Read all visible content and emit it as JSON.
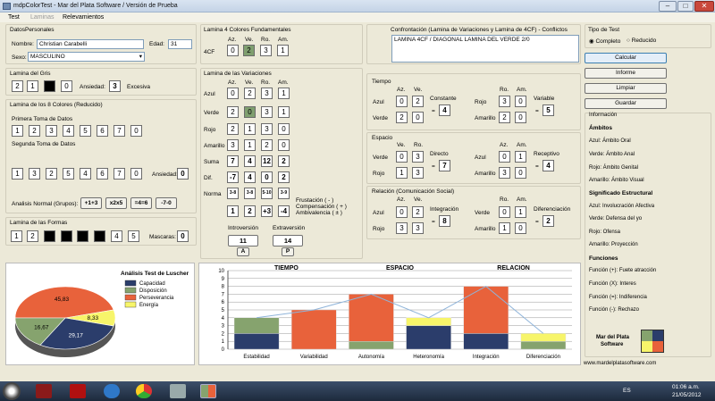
{
  "window": {
    "title": "mdpColorTest - Mar del Plata Software / Versión de Prueba"
  },
  "menu": {
    "test": "Test",
    "laminas": "Laminas",
    "relevamientos": "Relevamientos"
  },
  "datos": {
    "title": "DatosPersonales",
    "nombre_label": "Nombre:",
    "nombre": "Christian Carabelli",
    "edad_label": "Edad:",
    "edad": "31",
    "sexo_label": "Sexo:",
    "sexo": "MASCULINO"
  },
  "gris": {
    "title": "Lamina del Gris",
    "ansiedad_label": "Ansiedad:",
    "ansiedad": "3",
    "excesiva": "Excesiva"
  },
  "ocho": {
    "title": "Lamina de los 8 Colores (Reducido)",
    "primera": "Primera Toma de Datos",
    "segunda": "Segunda Toma de Datos",
    "row1": [
      "1",
      "2",
      "3",
      "4",
      "5",
      "6",
      "7",
      "0"
    ],
    "row2": [
      "1",
      "3",
      "2",
      "5",
      "4",
      "6",
      "7",
      "0"
    ],
    "ansiedad_label": "Ansiedad:",
    "ansiedad": "0",
    "normal_label": "Analisis Normal (Grupos):",
    "grupos": [
      "+1+3",
      "x2x5",
      "=4=6",
      "-7-0"
    ]
  },
  "formas": {
    "title": "Lamina de las Formas",
    "c1": "1",
    "c2": "2",
    "c7": "4",
    "c8": "5",
    "mascaras_label": "Mascaras:",
    "mascaras": "0"
  },
  "fund": {
    "title": "Lamina 4 Colores Fundamentales",
    "headers": [
      "Az.",
      "Ve.",
      "Ro.",
      "Am."
    ],
    "row_label": "4CF",
    "values": [
      "0",
      "2",
      "3",
      "1"
    ]
  },
  "variaciones": {
    "title": "Lamina de las Variaciones",
    "headers": [
      "Az.",
      "Ve.",
      "Ro.",
      "Am."
    ],
    "rows": [
      {
        "label": "Azul",
        "v": [
          "0",
          "2",
          "3",
          "1"
        ]
      },
      {
        "label": "Verde",
        "v": [
          "2",
          "0",
          "3",
          "1"
        ]
      },
      {
        "label": "Rojo",
        "v": [
          "2",
          "1",
          "3",
          "0"
        ]
      },
      {
        "label": "Amarillo",
        "v": [
          "3",
          "1",
          "2",
          "0"
        ]
      },
      {
        "label": "Suma",
        "v": [
          "7",
          "4",
          "12",
          "2"
        ]
      },
      {
        "label": "Dif.",
        "v": [
          "-7",
          "4",
          "0",
          "2"
        ]
      },
      {
        "label": "Norma",
        "v": [
          "3-8",
          "3-8",
          "5-10",
          "3-9"
        ]
      },
      {
        "label": "",
        "v": [
          "1",
          "2",
          "+3",
          "-4"
        ]
      }
    ],
    "frustacion": "Frustación ( - )",
    "compensacion": "Compensación ( + )",
    "ambivalencia": "Ambivalencia ( ± )",
    "intro_label": "Introversión",
    "intro": "11",
    "intro_tag": "A",
    "extra_label": "Extraversión",
    "extra": "14",
    "extra_tag": "P"
  },
  "confrontacion": {
    "title": "Confrontación (Lamina de Variaciones y Lamina de 4CF) - Conflictos",
    "text": "LAMINA 4CF / DIAGONAL LAMINA DEL VERDE 2/0"
  },
  "tiempo": {
    "title": "Tiempo",
    "az": "Az.",
    "ve": "Ve.",
    "ro": "Ro.",
    "am": "Am.",
    "azul": "Azul",
    "verde": "Verde",
    "rojo": "Rojo",
    "amarillo": "Amarillo",
    "l": [
      "0",
      "2",
      "2",
      "0"
    ],
    "constante_label": "Constante",
    "constante": "4",
    "r": [
      "3",
      "0",
      "2",
      "0"
    ],
    "variable_label": "Variable",
    "variable": "5"
  },
  "espacio": {
    "title": "Espacio",
    "ve": "Ve.",
    "ro": "Ro.",
    "az": "Az.",
    "am": "Am.",
    "verde": "Verde",
    "rojo": "Rojo",
    "azul": "Azul",
    "amarillo": "Amarillo",
    "l": [
      "0",
      "3",
      "1",
      "3"
    ],
    "directo_label": "Directo",
    "directo": "7",
    "r": [
      "0",
      "1",
      "3",
      "0"
    ],
    "receptivo_label": "Receptivo",
    "receptivo": "4"
  },
  "relacion": {
    "title": "Relación (Comunicación Social)",
    "az": "Az.",
    "ve": "Ve.",
    "ro": "Ro.",
    "am": "Am.",
    "azul": "Azul",
    "rojo": "Rojo",
    "verde": "Verde",
    "amarillo": "Amarillo",
    "l": [
      "0",
      "2",
      "3",
      "3"
    ],
    "integracion_label": "Integración",
    "integracion": "8",
    "r": [
      "0",
      "1",
      "1",
      "0"
    ],
    "diferenciacion_label": "Diferenciación",
    "diferenciacion": "2"
  },
  "tipo": {
    "title": "Tipo de Test",
    "completo": "Completo",
    "reducido": "Reducido"
  },
  "buttons": {
    "calcular": "Calcular",
    "informe": "Informe",
    "limpiar": "Limpiar",
    "guardar": "Guardar"
  },
  "info": {
    "title": "Información",
    "ambitos": "Ámbitos",
    "azul": "Azul: Ámbito Oral",
    "verde": "Verde: Ámbito Anal",
    "rojo": "Rojo: Ámbito Genital",
    "amarillo": "Amarillo: Ámbito Visual",
    "significado": "Significado Estructural",
    "s_azul": "Azul: Involucración Afectiva",
    "s_verde": "Verde: Defensa del yo",
    "s_rojo": "Rojo: Ofensa",
    "s_amarillo": "Amarillo: Proyección",
    "funciones": "Funciones",
    "f1": "Función (+): Fuete atracción",
    "f2": "Función (X): Interes",
    "f3": "Función (=): Indiferencia",
    "f4": "Función (-): Rechazo",
    "logo1": "Mar del Plata",
    "logo2": "Software",
    "website": "www.mardelplatasoftware.com"
  },
  "colors": {
    "capacidad": "#2b3d6b",
    "disposicion": "#86a36e",
    "perseverancia": "#e8623b",
    "energia": "#f7f56a"
  },
  "chart_data": [
    {
      "type": "pie",
      "title": "Análisis Test de Luscher",
      "labels": [
        "Capacidad",
        "Disposición",
        "Perseverancia",
        "Energía"
      ],
      "values": [
        29.17,
        16.67,
        45.83,
        8.33
      ],
      "value_labels": [
        "29,17",
        "16,67",
        "45,83",
        "8,33"
      ]
    },
    {
      "type": "bar",
      "stacked": true,
      "group_titles": [
        "TIEMPO",
        "ESPACIO",
        "RELACION"
      ],
      "categories": [
        "Estabilidad",
        "Variabilidad",
        "Autonomía",
        "Heteronomía",
        "Integración",
        "Diferenciación"
      ],
      "ylim": [
        0,
        10
      ],
      "yticks": [
        "0",
        "1",
        "2",
        "3",
        "4",
        "5",
        "6",
        "7",
        "8",
        "9",
        "10"
      ],
      "grid": true,
      "series": [
        {
          "name": "Capacidad",
          "values": [
            2,
            0,
            0,
            3,
            2,
            0
          ]
        },
        {
          "name": "Disposición",
          "values": [
            2,
            0,
            1,
            0,
            0,
            1
          ]
        },
        {
          "name": "Perseverancia",
          "values": [
            0,
            5,
            6,
            0,
            6,
            0
          ]
        },
        {
          "name": "Energía",
          "values": [
            0,
            0,
            0,
            1,
            0,
            1
          ]
        }
      ],
      "line_values": [
        4,
        5,
        7,
        4,
        8,
        2
      ]
    }
  ],
  "taskbar": {
    "time": "01:06 a.m.",
    "date": "21/05/2012",
    "lang": "ES"
  }
}
